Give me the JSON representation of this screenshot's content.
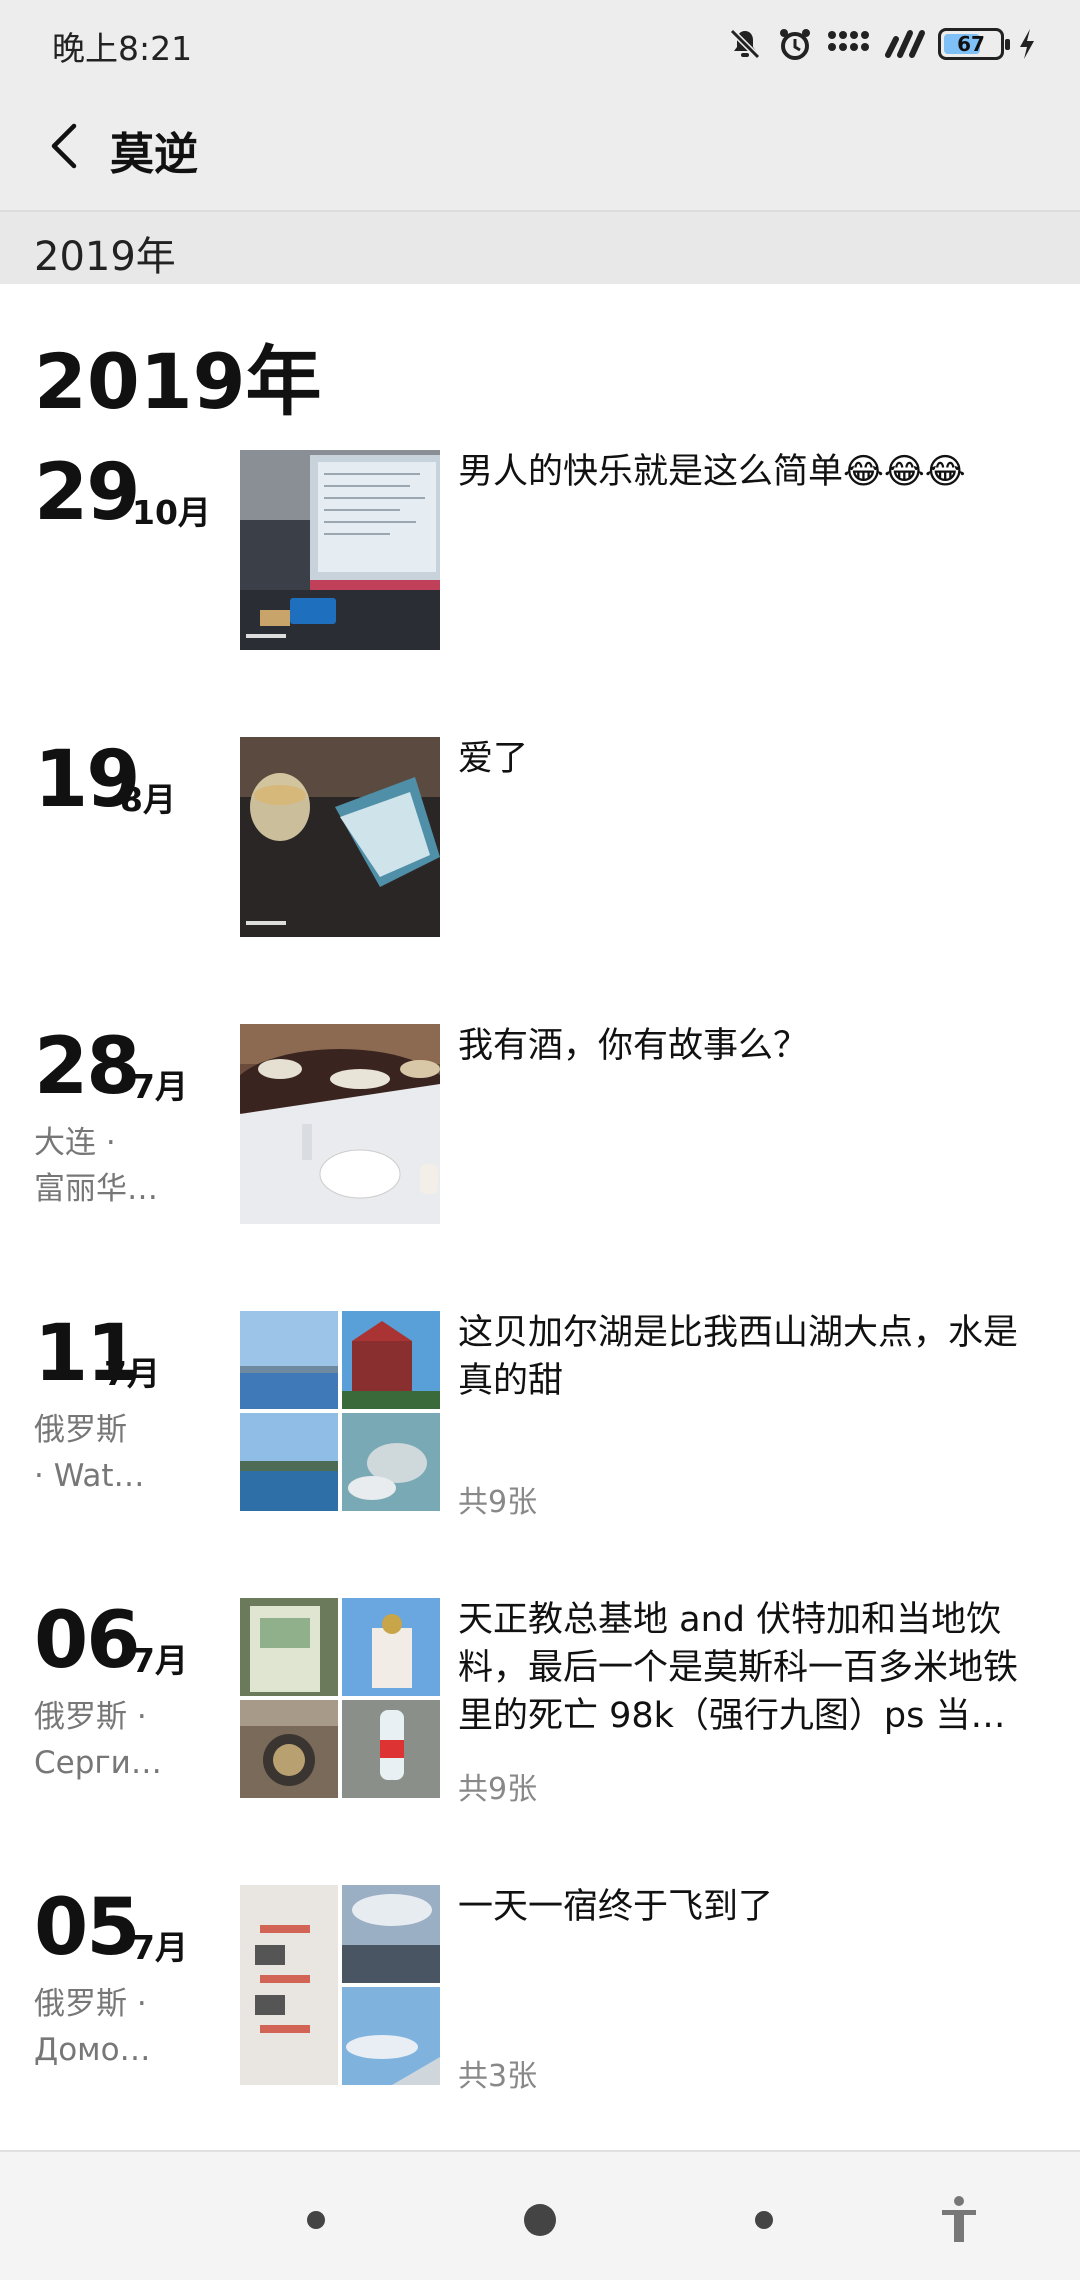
{
  "status_bar": {
    "time": "晚上8:21",
    "battery_level": "67",
    "battery_fraction": 0.67,
    "icons": [
      "mute-icon",
      "alarm-icon",
      "dots-icon",
      "signal-icon",
      "battery-icon",
      "charging-icon"
    ]
  },
  "header": {
    "title": "莫逆",
    "back_icon": "chevron-left-icon"
  },
  "year_bar": {
    "label": "2019年"
  },
  "year_heading": "2019年",
  "posts": [
    {
      "day": "29",
      "month": "10月",
      "location_line1": "",
      "location_line2": "",
      "text": "男人的快乐就是这么简单😂😂😂",
      "count": "",
      "photos": 1
    },
    {
      "day": "19",
      "month": "8月",
      "location_line1": "",
      "location_line2": "",
      "text": "爱了",
      "count": "",
      "photos": 1
    },
    {
      "day": "28",
      "month": "7月",
      "location_line1": "大连 ·",
      "location_line2": "富丽华…",
      "text": "我有酒，你有故事么？",
      "count": "",
      "photos": 1
    },
    {
      "day": "11",
      "month": "7月",
      "location_line1": "俄罗斯",
      "location_line2": "· Wat…",
      "text": "这贝加尔湖是比我西山湖大点，水是真的甜",
      "count": "共9张",
      "photos": 4
    },
    {
      "day": "06",
      "month": "7月",
      "location_line1": "俄罗斯 ·",
      "location_line2": "Серги…",
      "text": "天正教总基地 and 伏特加和当地饮料，最后一个是莫斯科一百多米地铁里的死亡 98k（强行九图）ps 当…",
      "count": "共9张",
      "photos": 4
    },
    {
      "day": "05",
      "month": "7月",
      "location_line1": "俄罗斯 ·",
      "location_line2": "Домо…",
      "text": "一天一宿终于飞到了",
      "count": "共3张",
      "photos": 3
    }
  ],
  "nav": {
    "accessibility_icon": "accessibility-icon"
  },
  "colors": {
    "header_bg": "#ededed",
    "muted_text": "#777777",
    "battery_fill": "#7fc0f7"
  }
}
